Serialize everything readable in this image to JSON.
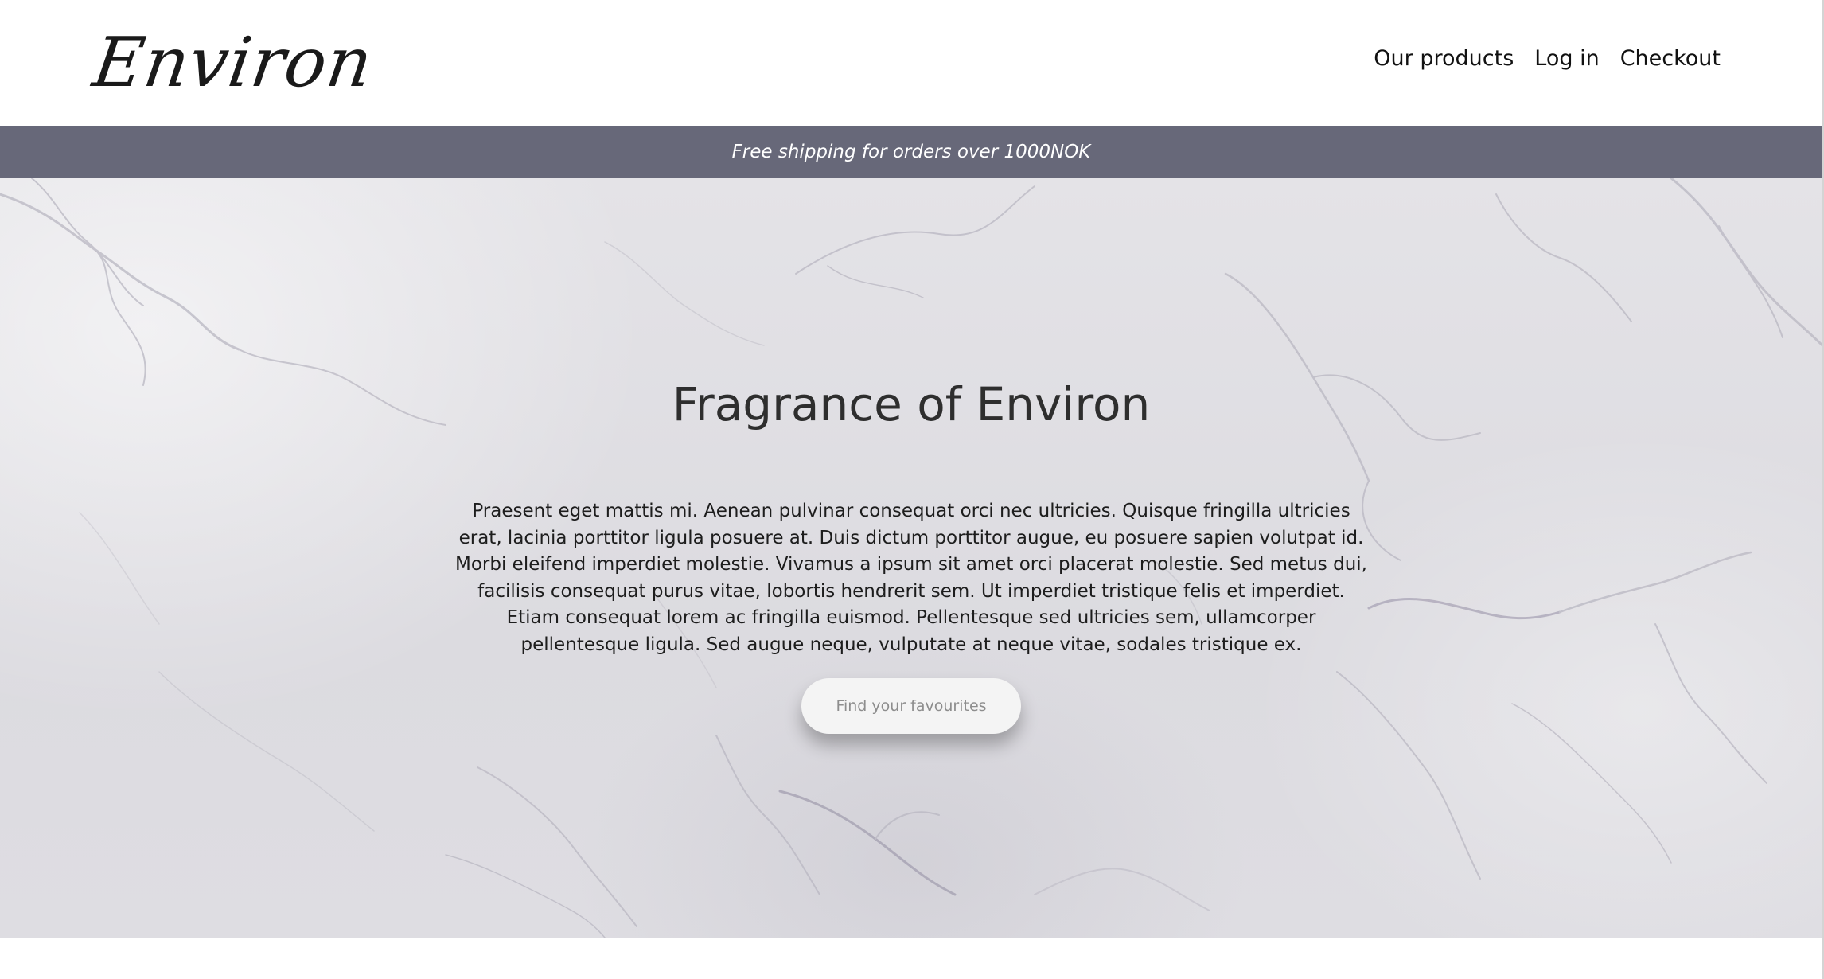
{
  "header": {
    "logo_text": "Environ",
    "nav": [
      {
        "label": "Our products"
      },
      {
        "label": "Log in"
      },
      {
        "label": "Checkout"
      }
    ]
  },
  "banner": {
    "text": "Free shipping for orders over 1000NOK",
    "background_color": "#676879"
  },
  "hero": {
    "title": "Fragrance of Environ",
    "body": "Praesent eget mattis mi. Aenean pulvinar consequat orci nec ultricies. Quisque fringilla ultricies erat, lacinia porttitor ligula posuere at. Duis dictum porttitor augue, eu posuere sapien volutpat id. Morbi eleifend imperdiet molestie. Vivamus a ipsum sit amet orci placerat molestie. Sed metus dui, facilisis consequat purus vitae, lobortis hendrerit sem. Ut imperdiet tristique felis et imperdiet. Etiam consequat lorem ac fringilla euismod. Pellentesque sed ultricies sem, ullamcorper pellentesque ligula. Sed augue neque, vulputate at neque vitae, sodales tristique ex.",
    "button_label": "Find your favourites",
    "background": "marble-texture"
  }
}
